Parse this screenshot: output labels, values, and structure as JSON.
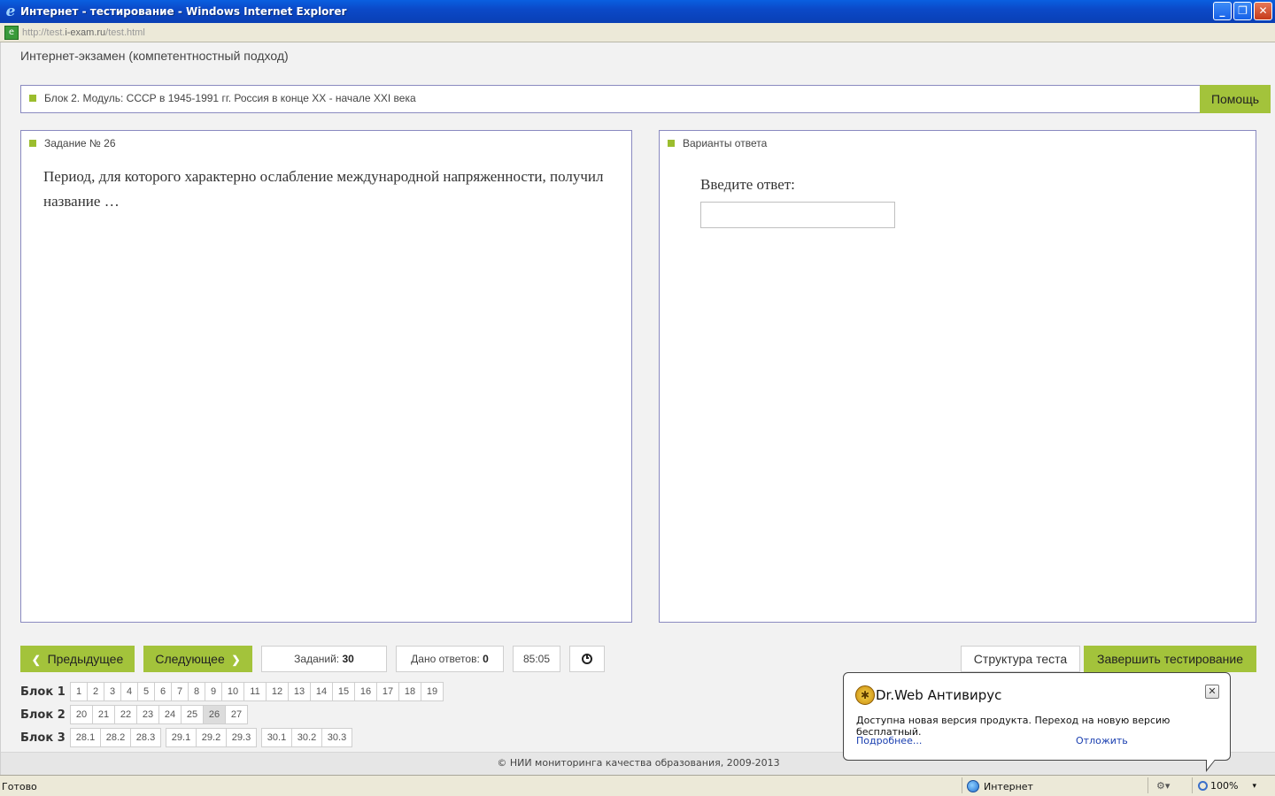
{
  "window": {
    "title": "Интернет - тестирование - Windows Internet Explorer",
    "controls": {
      "minimize": "_",
      "restore": "❐",
      "close": "✕"
    }
  },
  "address": {
    "prefix": "http://test.",
    "domain": "i-exam.ru",
    "path": "/test.html"
  },
  "page": {
    "exam_title": "Интернет-экзамен (компетентностный подход)",
    "block_label": "Блок 2. Модуль: СССР в 1945-1991 гг. Россия в конце XX - начале XXI века",
    "help_label": "Помощь",
    "task_header": "Задание № 26",
    "question": "Период, для которого характерно ослабление международной напряженности, получил название …",
    "answers_header": "Варианты ответа",
    "answer_prompt": "Введите ответ:",
    "answer_value": ""
  },
  "controls": {
    "prev_label": "Предыдущее",
    "next_label": "Следующее",
    "tasks_label": "Заданий:",
    "tasks_count": "30",
    "answered_label": "Дано ответов:",
    "answered_count": "0",
    "timer": "85:05",
    "structure_label": "Структура теста",
    "finish_label": "Завершить тестирование"
  },
  "blocks": [
    {
      "label": "Блок 1",
      "items": [
        "1",
        "2",
        "3",
        "4",
        "5",
        "6",
        "7",
        "8",
        "9",
        "10",
        "11",
        "12",
        "13",
        "14",
        "15",
        "16",
        "17",
        "18",
        "19"
      ]
    },
    {
      "label": "Блок 2",
      "items": [
        "20",
        "21",
        "22",
        "23",
        "24",
        "25",
        "26",
        "27"
      ],
      "current": "26"
    },
    {
      "label": "Блок 3",
      "items": [
        "28.1",
        "28.2",
        "28.3",
        "29.1",
        "29.2",
        "29.3",
        "30.1",
        "30.2",
        "30.3"
      ]
    }
  ],
  "footer": "© НИИ мониторинга качества образования, 2009-2013",
  "popup": {
    "title": "Dr.Web Антивирус",
    "text": "Доступна новая версия продукта. Переход на новую версию бесплатный.",
    "more_link": "Подробнее...",
    "later_link": "Отложить",
    "close": "✕"
  },
  "status": {
    "text": "Готово",
    "zone": "Интернет",
    "zoom": "100%"
  },
  "colors": {
    "accent": "#a3c33b",
    "border": "#8a8ac0"
  }
}
